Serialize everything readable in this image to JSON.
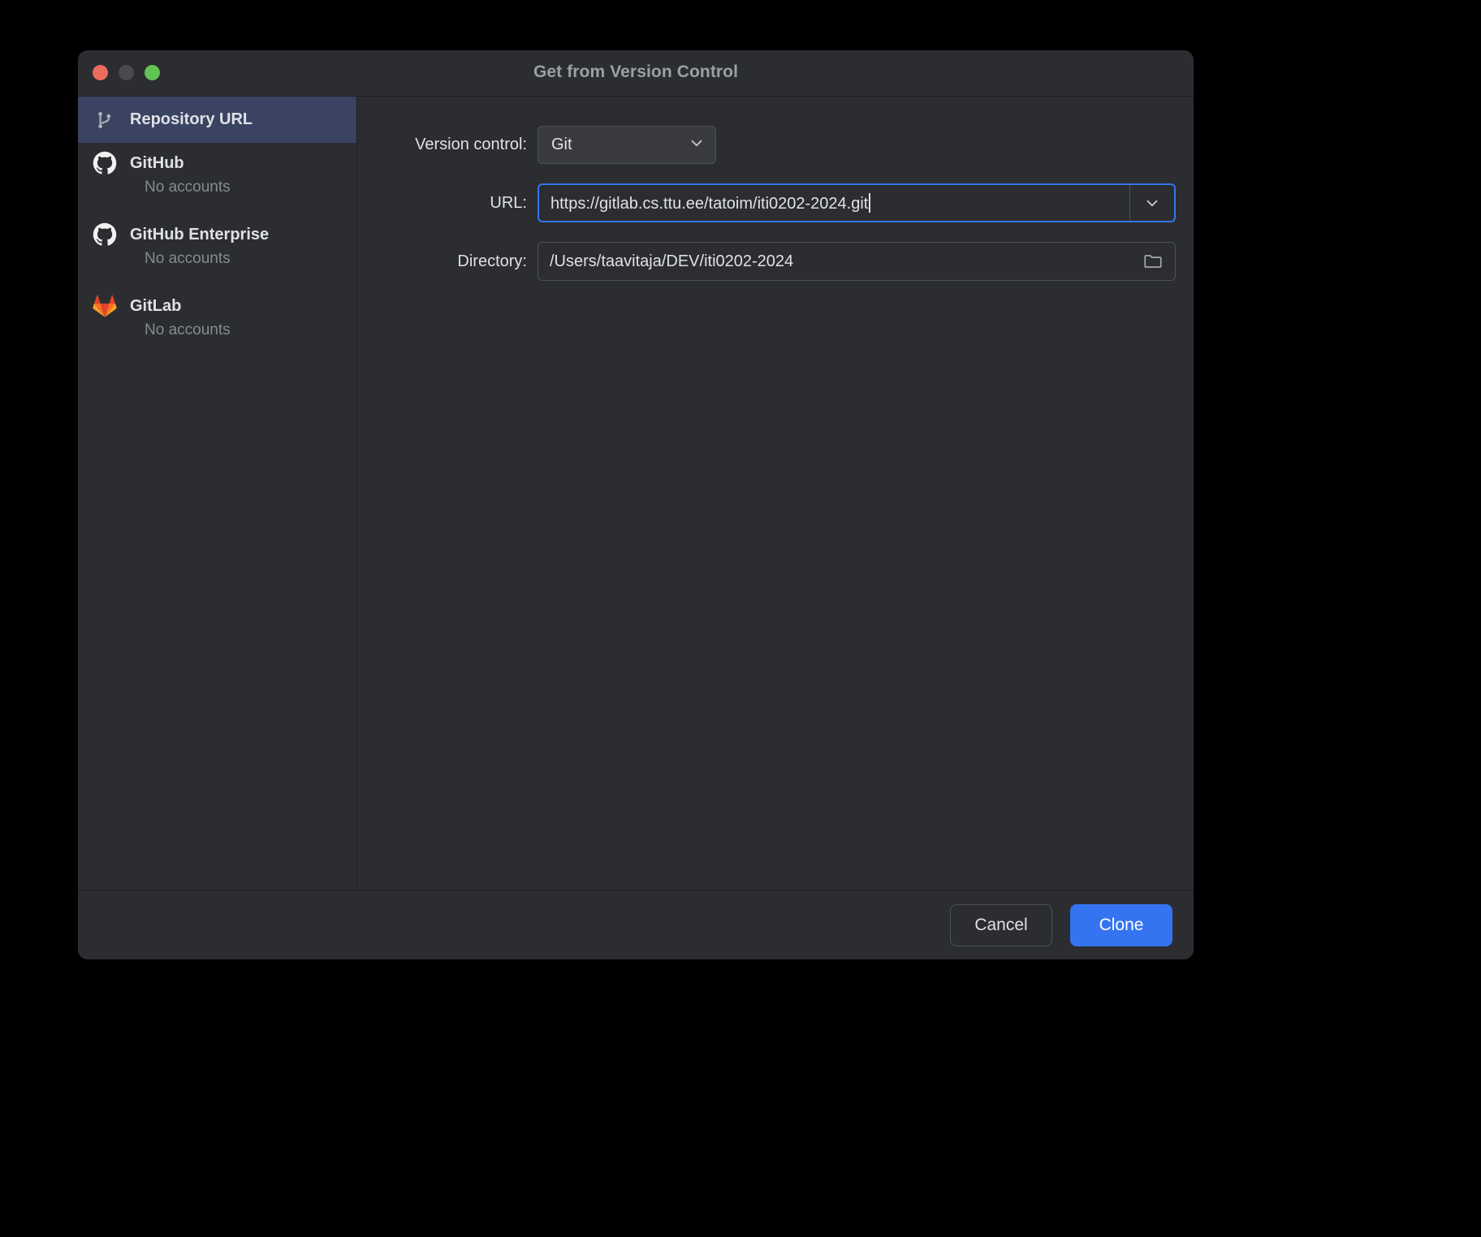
{
  "window": {
    "title": "Get from Version Control",
    "traffic_lights": [
      "close-button",
      "minimize-button",
      "maximize-button"
    ],
    "colors": {
      "close": "#ed6a5e",
      "minimize": "#4a4a4a",
      "maximize": "#61c454",
      "background": "#2b2d30",
      "selection": "#3a4362",
      "accent": "#3574f0",
      "gitlab_orange": "#e24329"
    }
  },
  "sidebar": {
    "items": [
      {
        "label": "Repository URL",
        "icon": "git-branch-icon",
        "selected": true,
        "subtitle": ""
      },
      {
        "label": "GitHub",
        "icon": "github-icon",
        "selected": false,
        "subtitle": "No accounts"
      },
      {
        "label": "GitHub Enterprise",
        "icon": "github-icon",
        "selected": false,
        "subtitle": "No accounts"
      },
      {
        "label": "GitLab",
        "icon": "gitlab-icon",
        "selected": false,
        "subtitle": "No accounts"
      }
    ]
  },
  "form": {
    "version_control": {
      "label": "Version control:",
      "value": "Git",
      "options": [
        "Git"
      ],
      "chevron": "chevron-down-icon"
    },
    "url": {
      "label": "URL:",
      "value": "https://gitlab.cs.ttu.ee/tatoim/iti0202-2024.git",
      "placeholder": "",
      "focused": true,
      "dropdown_icon": "chevron-down-icon"
    },
    "directory": {
      "label": "Directory:",
      "value": "/Users/taavitaja/DEV/iti0202-2024",
      "placeholder": "",
      "browse_icon": "folder-icon"
    }
  },
  "footer": {
    "cancel_label": "Cancel",
    "clone_label": "Clone"
  }
}
